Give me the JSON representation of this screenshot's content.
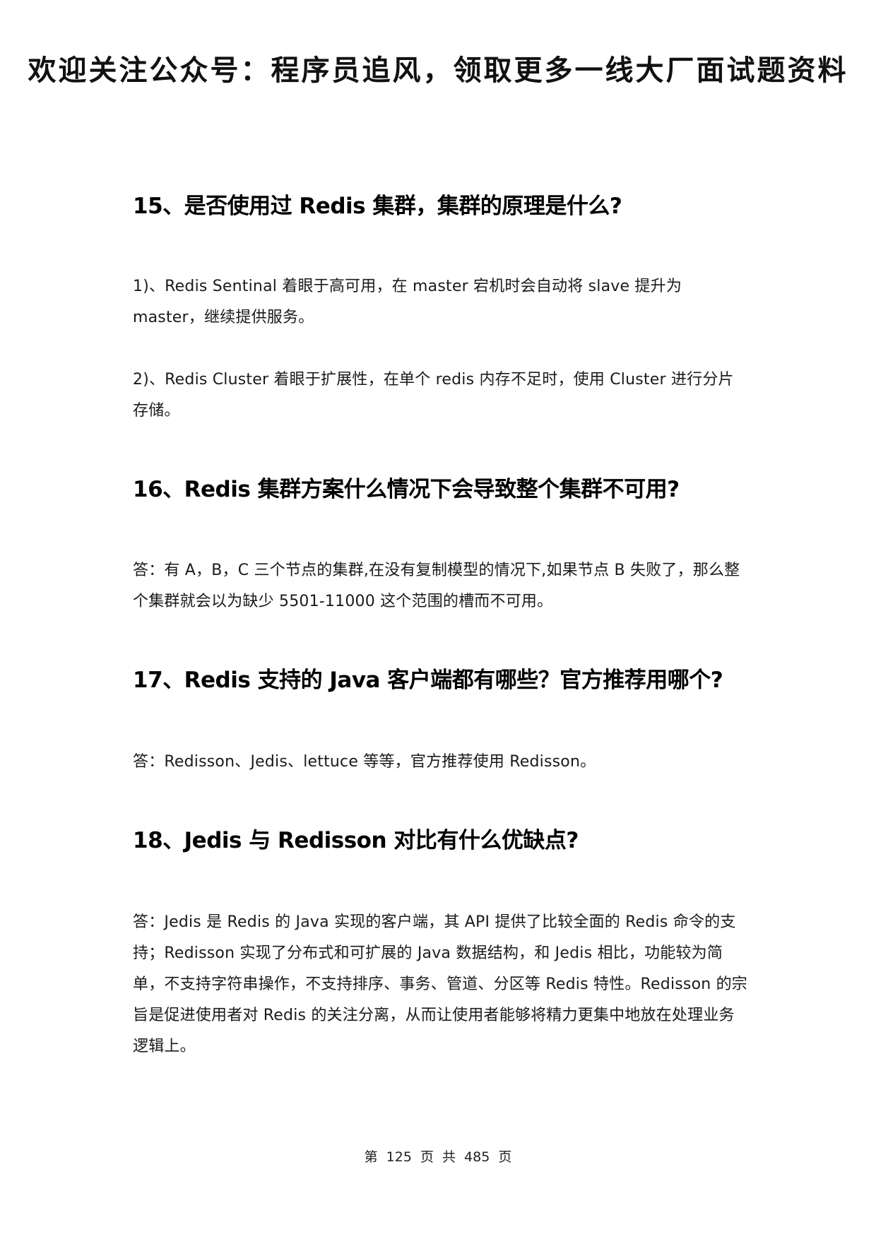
{
  "banner": {
    "text": "欢迎关注公众号：程序员追风，领取更多一线大厂面试题资料"
  },
  "sections": {
    "q15": {
      "title": "15、是否使用过 Redis 集群，集群的原理是什么?",
      "p1": "1)、Redis Sentinal 着眼于高可用，在 master 宕机时会自动将 slave 提升为 master，继续提供服务。",
      "p2": "2)、Redis Cluster 着眼于扩展性，在单个 redis 内存不足时，使用 Cluster 进行分片存储。"
    },
    "q16": {
      "title": "16、Redis 集群方案什么情况下会导致整个集群不可用?",
      "p1": "答：有 A，B，C 三个节点的集群,在没有复制模型的情况下,如果节点 B 失败了，那么整个集群就会以为缺少 5501-11000 这个范围的槽而不可用。"
    },
    "q17": {
      "title": "17、Redis 支持的 Java 客户端都有哪些？官方推荐用哪个?",
      "p1": "答：Redisson、Jedis、lettuce 等等，官方推荐使用 Redisson。"
    },
    "q18": {
      "title": "18、Jedis 与 Redisson 对比有什么优缺点?",
      "p1": "答：Jedis 是 Redis 的 Java 实现的客户端，其 API 提供了比较全面的 Redis 命令的支持；Redisson 实现了分布式和可扩展的 Java 数据结构，和 Jedis 相比，功能较为简单，不支持字符串操作，不支持排序、事务、管道、分区等 Redis 特性。Redisson 的宗旨是促进使用者对 Redis 的关注分离，从而让使用者能够将精力更集中地放在处理业务逻辑上。"
    }
  },
  "footer": {
    "page_info": "第 125 页 共 485 页"
  }
}
